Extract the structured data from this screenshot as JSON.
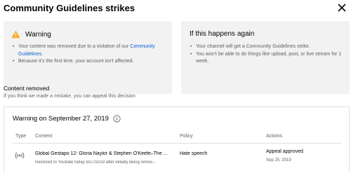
{
  "header": {
    "title": "Community Guidelines strikes",
    "close_icon": "close-icon"
  },
  "warning_card": {
    "icon": "warning-triangle-icon",
    "icon_color": "#f9a825",
    "title": "Warning",
    "bullet_1_prefix": "Your content was removed due to a violation of our ",
    "bullet_1_link": "Community Guidelines",
    "bullet_1_suffix": ".",
    "bullet_2": "Because it's the first time, your account isn't affected."
  },
  "again_card": {
    "title": "If this happens again",
    "bullet_1": "Your channel will get a Community Guidelines strike.",
    "bullet_2": "You won't be able to do things like upload, post, or live stream for 1 week."
  },
  "removed_section": {
    "title": "Content removed",
    "subtitle": "If you think we made a mistake, you can appeal this decision"
  },
  "warning_panel": {
    "title": "Warning on September 27, 2019",
    "info_icon": "info-icon",
    "columns": {
      "type": "Type",
      "content": "Content",
      "policy": "Policy",
      "actions": "Actions"
    },
    "row": {
      "type_icon": "live-broadcast-icon",
      "content_title": "Global Gestapo 12: Gloria Naylor & Stephen O'Keefe–The ...",
      "content_sub": "Restored to Youtube today 9/27/2019 after initially being remov...",
      "policy": "Hate speech",
      "action": "Appeal approved",
      "action_date": "Sep 25, 2019"
    }
  },
  "colors": {
    "card_bg": "#f2f2f2",
    "link": "#065fd4",
    "secondary_text": "#606060"
  }
}
